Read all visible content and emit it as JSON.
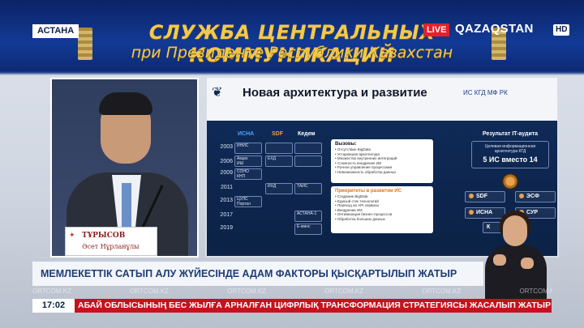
{
  "broadcast": {
    "location_badge": "АСТАНА",
    "live_label": "LIVE",
    "channel_name": "QAZAQSTAN",
    "hd_label": "HD",
    "time": "17:02"
  },
  "banner": {
    "line1": "СЛУЖБА ЦЕНТРАЛЬНЫХ КОММУНИКАЦИЙ",
    "line2": "при Президенте Республики Казахстан"
  },
  "speaker": {
    "nameplate_name": "ТҰРЫСОВ",
    "nameplate_sub": "Әсет Нұрланұлы"
  },
  "slide": {
    "title": "Новая архитектура и развитие",
    "subtitle": "ИС КГД МФ РК",
    "columns": [
      "ИСНА",
      "SDF",
      "Кедем"
    ],
    "years": [
      "2003",
      "2006",
      "2009",
      "2011",
      "2013",
      "2017",
      "2019"
    ],
    "cells": {
      "isna_2003": "ИНИС",
      "isna_2006": "Акциз\nИШ",
      "isna_2009": "СОНО\nКНП",
      "isna_2013": "ЦУЛС\nПортал",
      "sdf_2006": "ЕХД",
      "sdf_2011": "ИХД",
      "kedem_2011": "ТАИС",
      "kedem_2017": "АСТАНА-1",
      "kedem_2019": "Е-минс"
    },
    "calls": {
      "title": "Вызовы:",
      "items": [
        "Отсутствие BigData",
        "Устаревшая архитектура",
        "Множество внутренних интеграций",
        "Сложность внедрения ИИ",
        "Ручное управление процессами",
        "Невозможность обработки данных"
      ]
    },
    "priorities": {
      "title": "Приоритеты в развитии ИС",
      "items": [
        "Создание BigData",
        "Единый стек технологий",
        "Переход на API сервисы",
        "Внедрение ИИ",
        "Оптимизация бизнес-процессов",
        "Обработка больших данных"
      ]
    },
    "result": {
      "title": "Результат IT-аудита",
      "sub": "Целевая информационная архитектура КГД",
      "big": "5 ИС вместо 14"
    },
    "systems": [
      "SDF",
      "ЭСФ",
      "ИСНА",
      "СУР",
      "К"
    ]
  },
  "lower_third": {
    "headline": "МЕМЛЕКЕТТІК САТЫП АЛУ ЖҮЙЕСІНДЕ АДАМ ФАКТОРЫ ҚЫСҚАРТЫЛЫП ЖАТЫР",
    "watermark": "ORTCOM.KZ",
    "ticker": "АБАЙ ОБЛЫСЫНЫҢ БЕС ЖЫЛҒА АРНАЛҒАН ЦИФРЛЫҚ ТРАНСФОРМАЦИЯ СТРАТЕГИЯСЫ ЖАСАЛЫП ЖАТЫР"
  },
  "colors": {
    "ticker_red": "#c6121c",
    "banner_gold": "#f3c84b",
    "headline_blue": "#1d3c78",
    "isna_col": "#4aa3ff",
    "sdf_col": "#e8a24a",
    "kedem_col": "#ffffff"
  }
}
